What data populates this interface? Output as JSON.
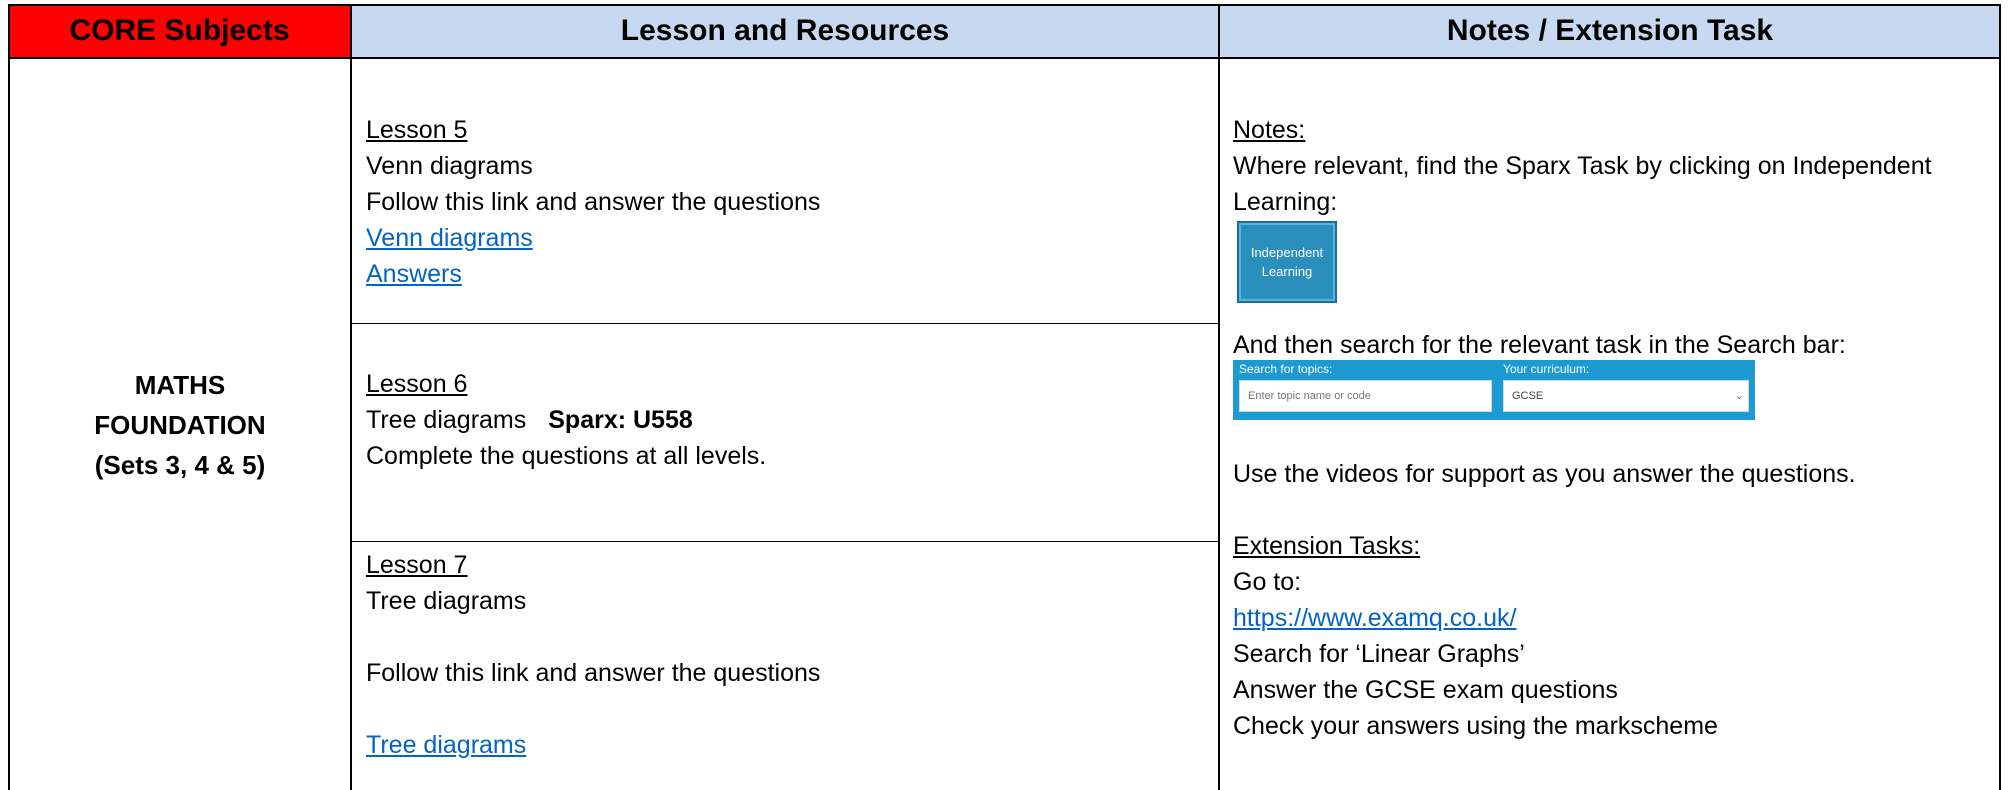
{
  "colors": {
    "subject_header_bg": "#ff0000",
    "header_bg": "#c6d9f1",
    "link": "#0563c1",
    "sparx_blue": "#1e9ad3"
  },
  "header": {
    "col1": "CORE Subjects",
    "col2": "Lesson and Resources",
    "col3": "Notes / Extension Task"
  },
  "subject": {
    "line1": "MATHS",
    "line2": "FOUNDATION",
    "line3": "(Sets 3, 4 & 5)"
  },
  "lessons": [
    {
      "title": "Lesson 5",
      "topic": "Venn diagrams",
      "instruction": "Follow this link and answer the questions",
      "link1": "Venn diagrams",
      "link2": "Answers"
    },
    {
      "title": "Lesson 6",
      "topic": "Tree diagrams",
      "sparx": "Sparx: U558",
      "instruction": "Complete the questions at all levels."
    },
    {
      "title": "Lesson 7",
      "topic": "Tree diagrams",
      "instruction": "Follow this link and answer the questions",
      "link1": "Tree diagrams"
    }
  ],
  "notes": {
    "heading": "Notes:",
    "line1": "Where relevant, find the Sparx Task by clicking on Independent",
    "line2": "Learning:",
    "button_line1": "Independent",
    "button_line2": "Learning",
    "search_instruction": "And then search for the relevant task in the Search bar:",
    "search_topics_label": "Search for topics:",
    "search_topics_placeholder": "Enter topic name or code",
    "curriculum_label": "Your curriculum:",
    "curriculum_value": "GCSE",
    "videos_line": "Use the videos for support as you answer the questions.",
    "extension_heading": "Extension Tasks:",
    "goto": "Go to:",
    "url": "https://www.examq.co.uk/",
    "search_for": "Search for ‘Linear Graphs’",
    "answer": "Answer the GCSE exam questions",
    "check": "Check your answers using the markscheme"
  }
}
